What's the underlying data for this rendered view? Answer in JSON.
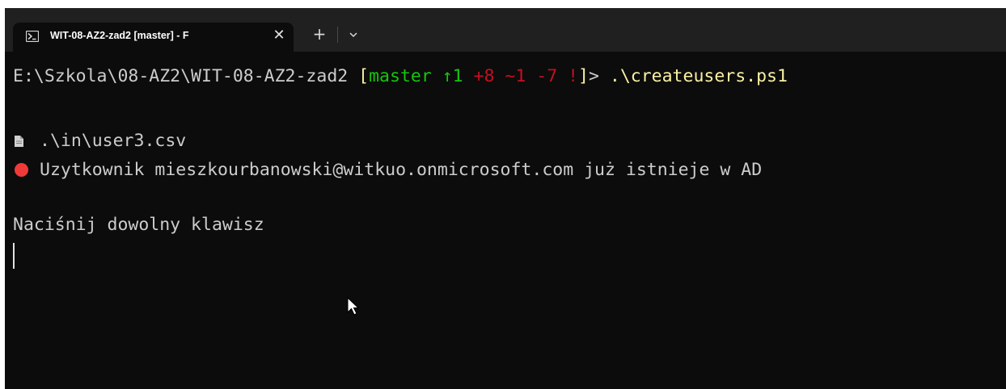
{
  "tab": {
    "icon": "powershell-icon",
    "title": "WIT-08-AZ2-zad2 [master] - F",
    "close_label": "✕"
  },
  "tabbar": {
    "new_tab_label": "+",
    "dropdown_icon": "chevron-down-icon"
  },
  "terminal": {
    "prompt": {
      "path": "E:\\Szkola\\08-AZ2\\WIT-08-AZ2-zad2 ",
      "open_bracket": "[",
      "branch": "master",
      "ahead": " ↑1",
      "added": " +8",
      "modified": " ~1",
      "deleted": " -7",
      "bang": " !",
      "close_bracket": "]",
      "gt": "> ",
      "command": ".\\createusers.ps1"
    },
    "file_line": {
      "icon": "file-icon",
      "text": ".\\in\\user3.csv"
    },
    "error_line": {
      "icon": "red-circle-icon",
      "text": "Uzytkownik mieszkourbanowski@witkuo.onmicrosoft.com już istnieje w AD"
    },
    "press_key": "Naciśnij dowolny klawisz"
  },
  "colors": {
    "background": "#0c0c0c",
    "tabbar": "#202020",
    "text": "#cccccc",
    "yellow": "#f9f1a5",
    "green": "#16c60c",
    "red": "#c50f1f",
    "error_dot": "#f03a3a"
  }
}
